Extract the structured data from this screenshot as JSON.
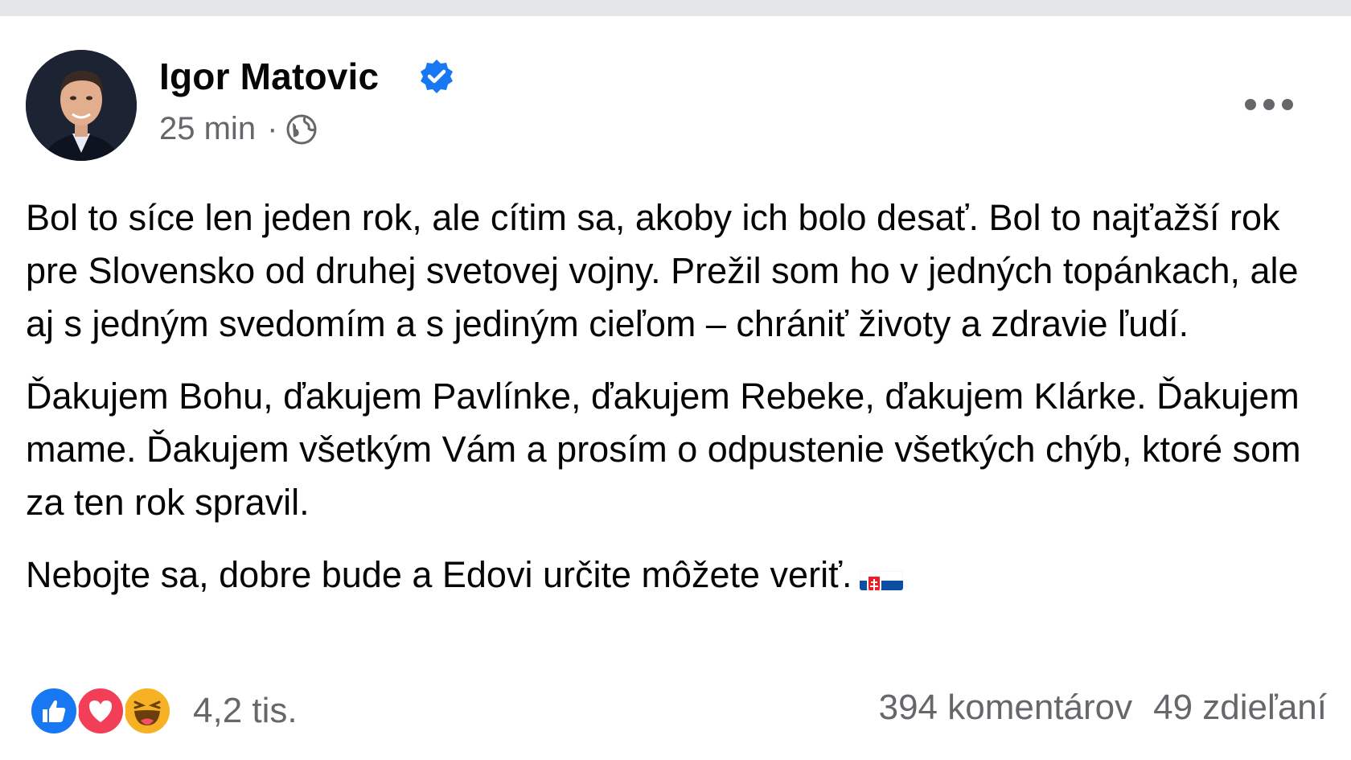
{
  "post": {
    "author": "Igor Matovic",
    "timestamp": "25 min",
    "separator": "·",
    "audience_icon": "globe-icon",
    "verified_icon": "verified-badge-icon",
    "more_icon": "more-options-icon",
    "paragraphs": [
      "Bol to síce len jeden rok, ale cítim sa, akoby ich bolo desať. Bol to najťažší rok pre Slovensko od druhej svetovej vojny. Prežil som ho v jedných topánkach, ale aj s jedným svedomím a s jediným cieľom – chrániť životy a zdravie ľudí.",
      "Ďakujem Bohu, ďakujem Pavlínke, ďakujem Rebeke, ďakujem Klárke. Ďakujem mame. Ďakujem všetkým Vám a prosím o odpustenie všetkých chýb, ktoré som za ten rok spravil.",
      "Nebojte sa, dobre bude a Edovi určite môžete veriť."
    ],
    "flag_icon": "slovakia-flag-icon"
  },
  "engagement": {
    "reactions": [
      "like-icon",
      "love-icon",
      "haha-icon"
    ],
    "reaction_count": "4,2 tis.",
    "comments": "394 komentárov",
    "shares": "49 zdieľaní"
  },
  "colors": {
    "like": "#1877f2",
    "love": "#f33e58",
    "haha": "#f7b125",
    "secondary_text": "#65676b",
    "verified": "#1877f2"
  }
}
